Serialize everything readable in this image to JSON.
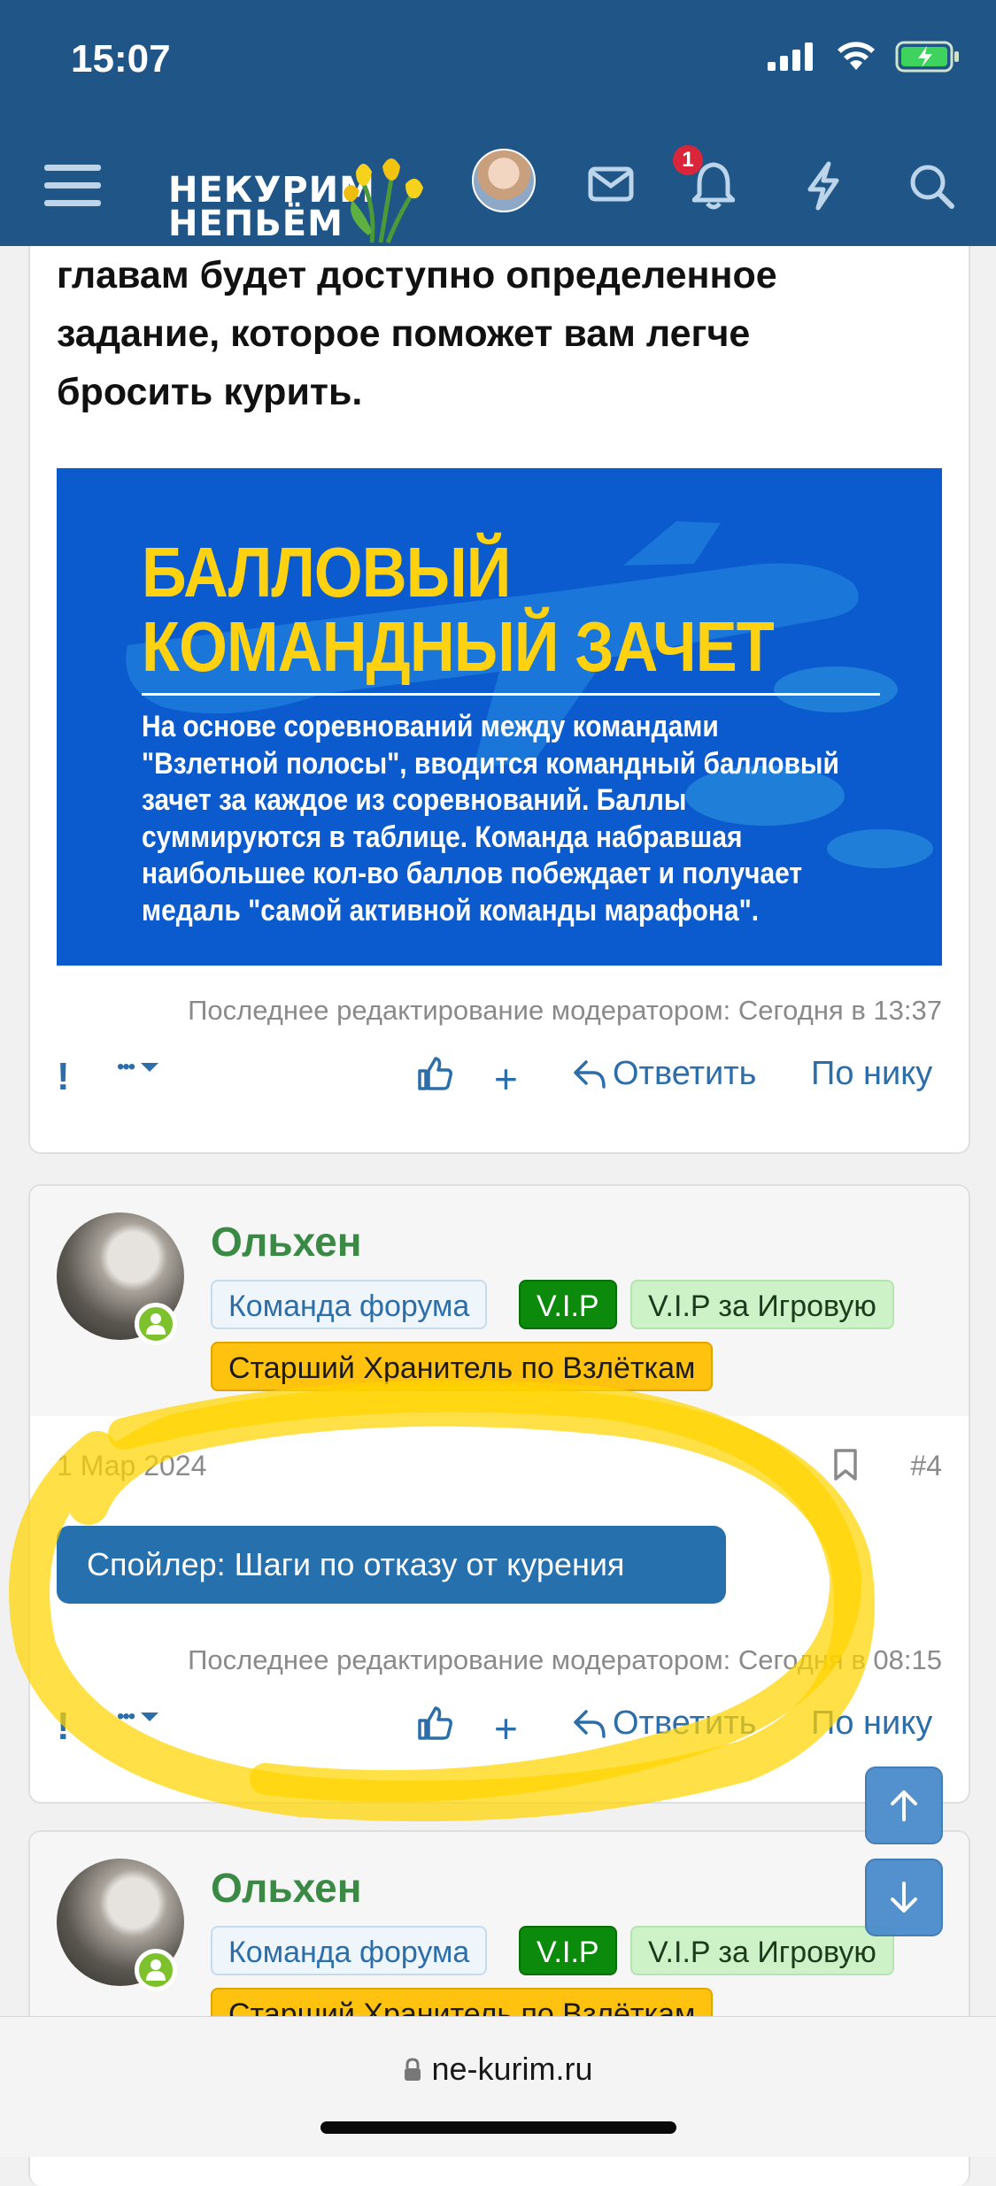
{
  "status_bar": {
    "time": "15:07"
  },
  "header": {
    "logo_line1": "НЕКУРИМ",
    "logo_line2": "НЕПЬЁМ",
    "notification_count": "1"
  },
  "post1": {
    "text_lines": [
      "главам будет доступно определенное",
      "задание, которое поможет вам легче",
      "бросить курить."
    ],
    "banner": {
      "title_line1": "БАЛЛОВЫЙ",
      "title_line2": "КОМАНДНЫЙ ЗАЧЕТ",
      "body_lines": [
        "На основе соревнований между командами",
        "\"Взлетной полосы\", вводится командный балловый",
        "зачет за каждое из соревнований. Баллы",
        "суммируются в таблице. Команда набравшая",
        "наибольшее кол-во баллов побеждает и получает",
        "медаль \"самой активной команды марафона\"."
      ]
    },
    "edit_note": "Последнее редактирование модератором: Сегодня в 13:37"
  },
  "actions": {
    "report": "!",
    "more": "•••",
    "plus": "+",
    "reply": "Ответить",
    "by_nick": "По нику"
  },
  "post2": {
    "username": "Ольхен",
    "badges": [
      "Команда форума",
      "V.I.P",
      "V.I.P за Игровую",
      "Старший Хранитель по Взлёткам"
    ],
    "date": "1 Мар 2024",
    "number": "#4",
    "spoiler": "Спойлер: Шаги по отказу от курения",
    "edit_note": "Последнее редактирование модератором: Сегодня в 08:15"
  },
  "post3": {
    "username": "Ольхен",
    "badges": [
      "Команда форума",
      "V.I.P",
      "V.I.P за Игровую",
      "Старший Хранитель по Взлёткам"
    ]
  },
  "browser": {
    "url": "ne-kurim.ru"
  },
  "colors": {
    "header": "#1f5687",
    "accent": "#2c6ea9",
    "username": "#3a8a46",
    "highlight": "#ffd400"
  }
}
